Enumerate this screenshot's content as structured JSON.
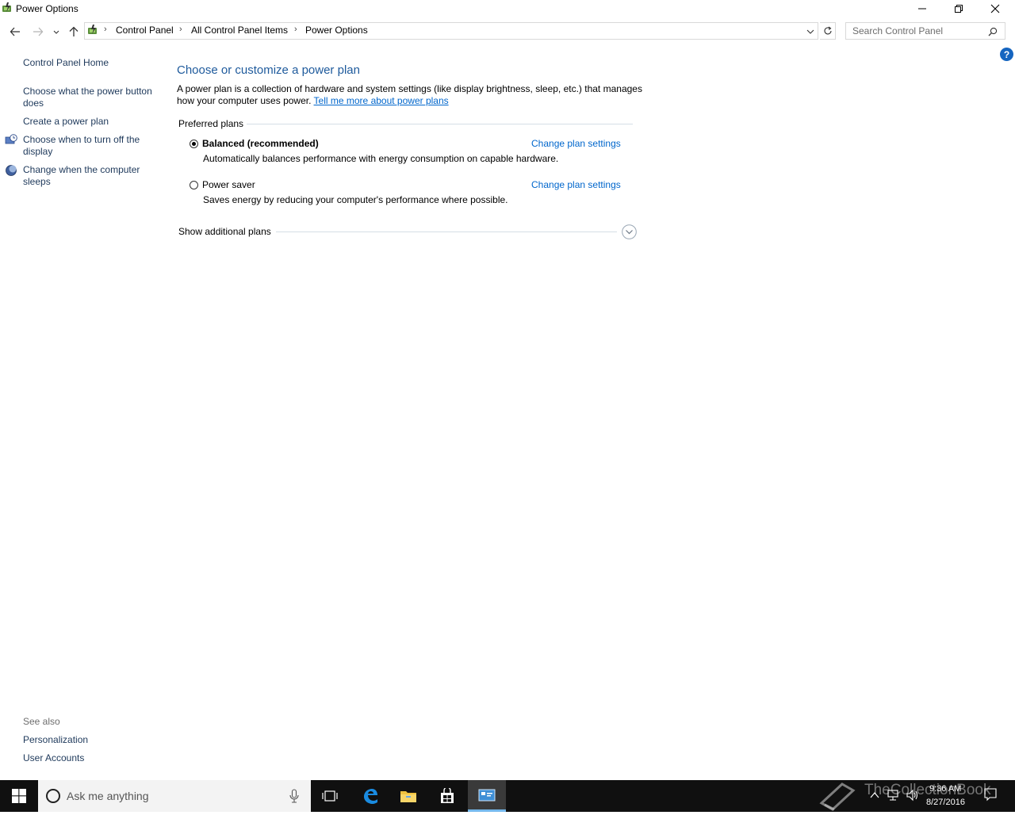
{
  "window": {
    "title": "Power Options",
    "icon": "power-options-icon"
  },
  "breadcrumb": {
    "items": [
      "Control Panel",
      "All Control Panel Items",
      "Power Options"
    ]
  },
  "search": {
    "placeholder": "Search Control Panel"
  },
  "sidebar": {
    "home": "Control Panel Home",
    "items": [
      {
        "label": "Choose what the power button does",
        "icon": ""
      },
      {
        "label": "Create a power plan",
        "icon": ""
      },
      {
        "label": "Choose when to turn off the display",
        "icon": "display-clock-icon"
      },
      {
        "label": "Change when the computer sleeps",
        "icon": "moon-globe-icon"
      }
    ],
    "see_also": {
      "heading": "See also",
      "links": [
        "Personalization",
        "User Accounts"
      ]
    }
  },
  "main": {
    "title": "Choose or customize a power plan",
    "intro": "A power plan is a collection of hardware and system settings (like display brightness, sleep, etc.) that manages how your computer uses power.",
    "intro_link": "Tell me more about power plans",
    "preferred_heading": "Preferred plans",
    "plans": [
      {
        "name": "Balanced (recommended)",
        "selected": true,
        "description": "Automatically balances performance with energy consumption on capable hardware.",
        "change_link": "Change plan settings"
      },
      {
        "name": "Power saver",
        "selected": false,
        "description": "Saves energy by reducing your computer's performance where possible.",
        "change_link": "Change plan settings"
      }
    ],
    "additional_heading": "Show additional plans"
  },
  "taskbar": {
    "search_placeholder": "Ask me anything",
    "clock_time": "9:36 AM",
    "clock_date": "8/27/2016",
    "watermark": "TheCollectionBook"
  },
  "colors": {
    "link": "#0066cc",
    "title": "#1e5a9c",
    "taskbar": "#101010",
    "active_app_accent": "#76b9ed"
  }
}
